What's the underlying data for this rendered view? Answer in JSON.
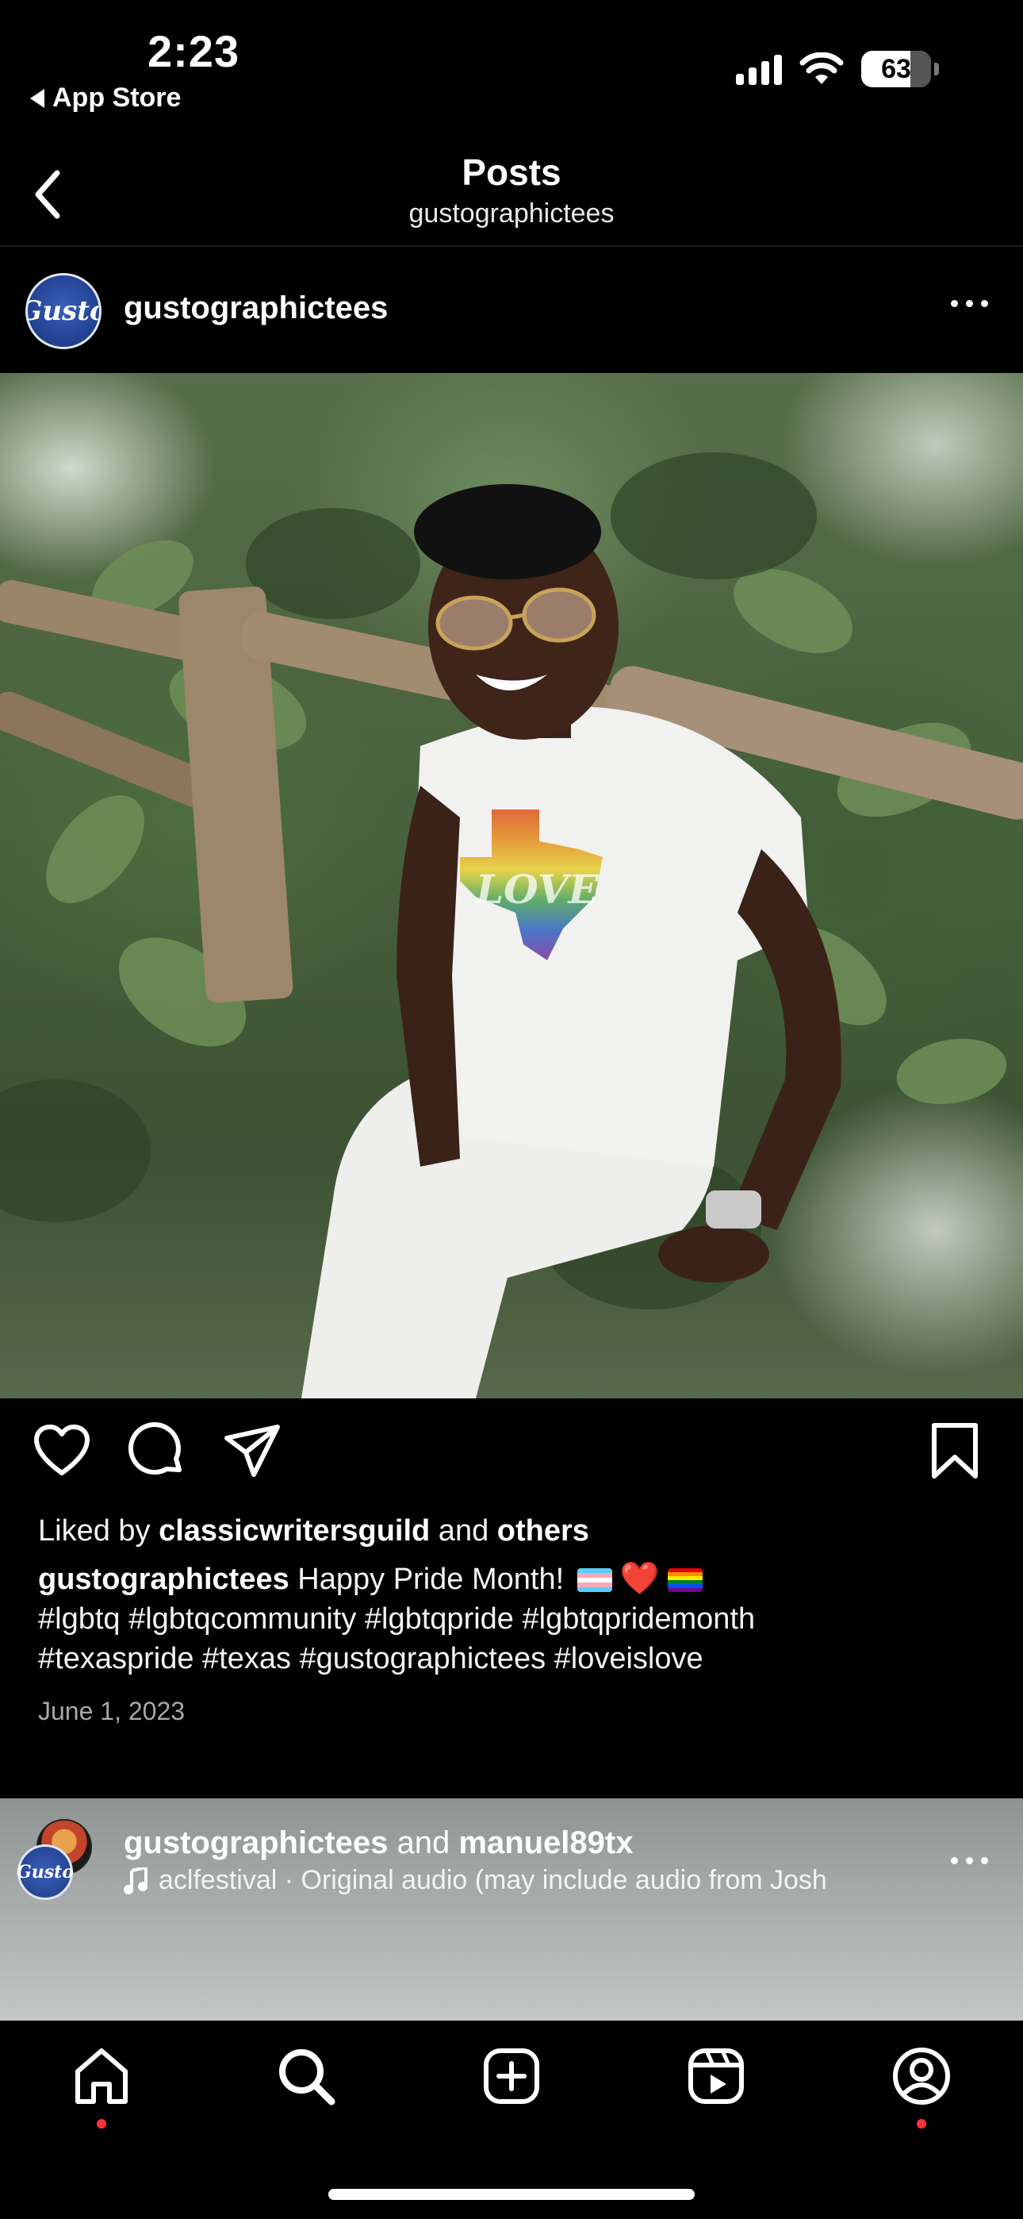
{
  "status_bar": {
    "time": "2:23",
    "back_app": "App Store",
    "battery": "63"
  },
  "header": {
    "title": "Posts",
    "subtitle": "gustographictees"
  },
  "post": {
    "username": "gustographictees",
    "avatar_text": "Gusto",
    "image_icon": "photo-person-pride-shirt",
    "liked_prefix": "Liked by ",
    "liked_user": "classicwritersguild",
    "liked_middle": " and ",
    "liked_others": "others",
    "caption_user": "gustographictees",
    "caption_text": " Happy Pride Month! ",
    "hashtags_line1": "#lgbtq #lgbtqcommunity #lgbtqpride #lgbtqpridemonth",
    "hashtags_line2": "#texaspride #texas #gustographictees #loveislove",
    "date": "June 1, 2023",
    "heart_emoji": "❤️"
  },
  "next_post": {
    "user1": "gustographictees",
    "joiner": " and ",
    "user2": "manuel89tx",
    "audio": "aclfestival · Original audio  (may include audio from Josh"
  },
  "colors": {
    "background": "#000000",
    "notification_dot": "#ff3040",
    "muted_text": "#a8a8a8"
  },
  "tabs": [
    "home-icon",
    "search-icon",
    "create-icon",
    "reels-icon",
    "profile-icon"
  ]
}
